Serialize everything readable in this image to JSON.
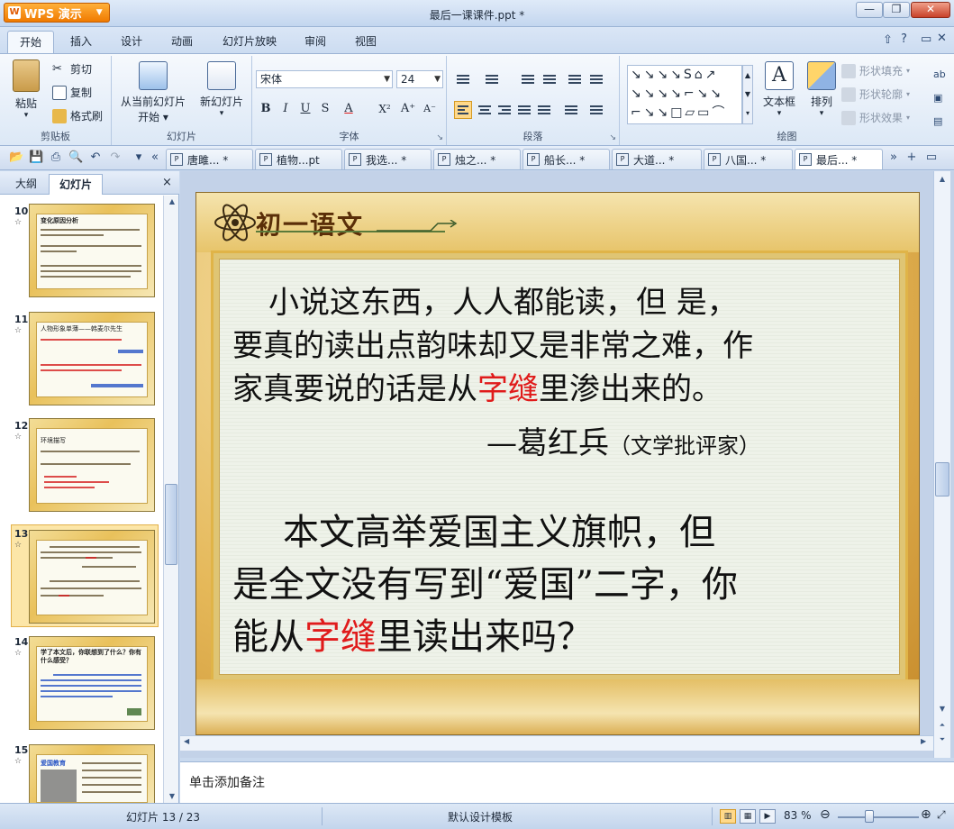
{
  "app": {
    "name": "WPS 演示",
    "document_title": "最后一课课件.ppt *"
  },
  "ribbon_tabs": [
    "开始",
    "插入",
    "设计",
    "动画",
    "幻灯片放映",
    "审阅",
    "视图"
  ],
  "clipboard": {
    "paste": "粘贴",
    "cut": "剪切",
    "copy": "复制",
    "format_painter": "格式刷",
    "label": "剪贴板"
  },
  "slides_group": {
    "from_current": "从当前幻灯片",
    "start": "开始",
    "new_slide": "新幻灯片",
    "label": "幻灯片"
  },
  "font": {
    "name": "宋体",
    "size": "24",
    "label": "字体",
    "bold": "B",
    "italic": "I",
    "underline": "U",
    "strike": "S",
    "color": "A",
    "superscript": "X²",
    "grow": "A⁺",
    "shrink": "A⁻"
  },
  "paragraph": {
    "label": "段落"
  },
  "drawing": {
    "text_box": "文本框",
    "arrange": "排列",
    "shape_fill": "形状填充",
    "shape_outline": "形状轮廓",
    "shape_effect": "形状效果",
    "label": "绘图"
  },
  "doc_tabs": [
    {
      "label": "唐雎... *"
    },
    {
      "label": "植物...pt"
    },
    {
      "label": "我选... *"
    },
    {
      "label": "烛之... *"
    },
    {
      "label": "船长... *"
    },
    {
      "label": "大道... *"
    },
    {
      "label": "八国... *"
    },
    {
      "label": "最后... *"
    }
  ],
  "left_panel": {
    "tabs": [
      "大纲",
      "幻灯片"
    ],
    "close": "×"
  },
  "thumbnails": [
    {
      "num": "10",
      "title": "变化原因分析"
    },
    {
      "num": "11",
      "title": "人物形象单薄——韩麦尔先生"
    },
    {
      "num": "12",
      "title": "环境描写"
    },
    {
      "num": "13",
      "title": ""
    },
    {
      "num": "14",
      "title": "学了本文后，你联想到了什么？你有什么感受？"
    },
    {
      "num": "15",
      "title": "爱国教育"
    }
  ],
  "slide": {
    "header": "初一语文",
    "quote_line1": "小说这东西，人人都能读，但 是，",
    "quote_line2": "要真的读出点韵味却又是非常之难，作",
    "quote_line3_a": "家真要说的话是从",
    "quote_line3_red": "字缝",
    "quote_line3_b": "里渗出来的。",
    "author": "—葛红兵",
    "author_note": "（文学批评家）",
    "q_line1": "本文高举爱国主义旗帜，但",
    "q_line2": "是全文没有写到“爱国”二字，你",
    "q_line3_a": "能从",
    "q_line3_red": "字缝",
    "q_line3_b": "里读出来吗？"
  },
  "notes_placeholder": "单击添加备注",
  "status": {
    "slide_counter": "幻灯片 13 / 23",
    "template": "默认设计模板",
    "zoom": "83 %"
  },
  "colors": {
    "accent_orange": "#f07a00",
    "highlight_red": "#e01b1b"
  }
}
